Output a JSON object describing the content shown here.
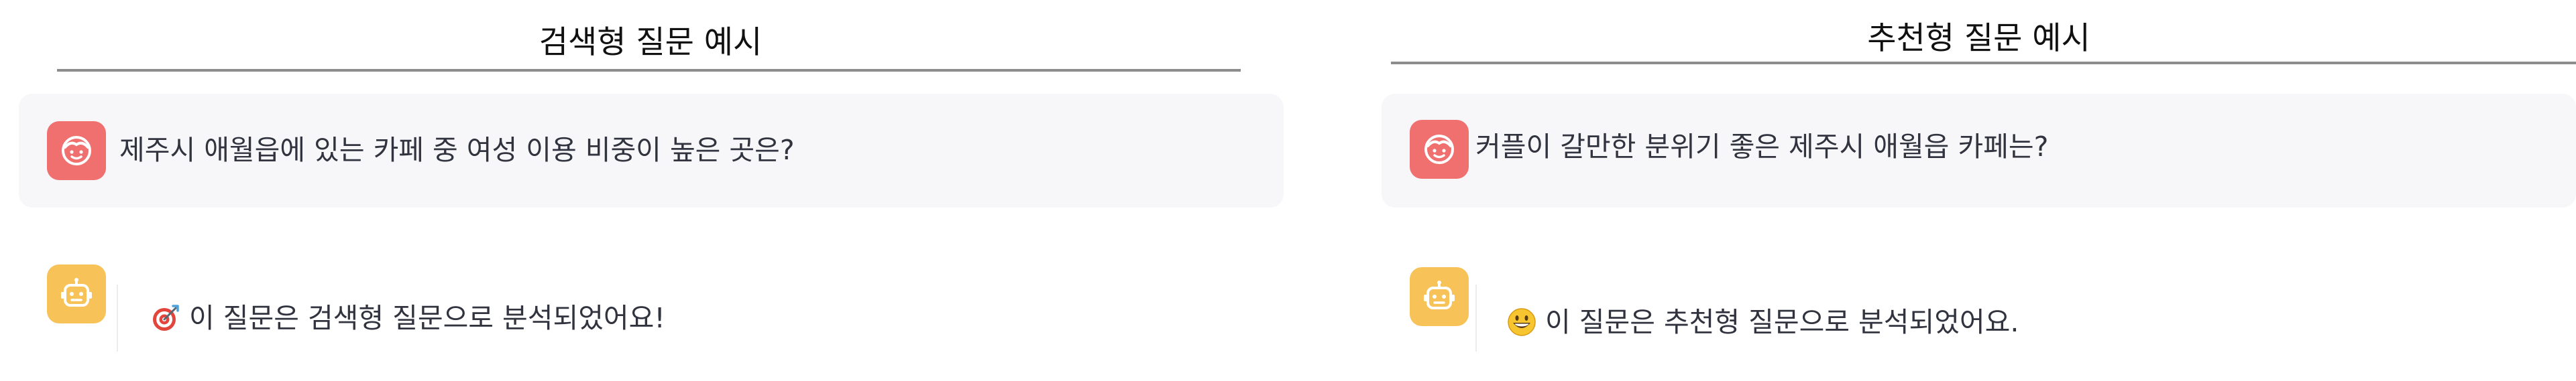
{
  "search_example": {
    "title": "검색형 질문 예시",
    "user_message": "제주시 애월읍에 있는 카페 중 여성 이용 비중이 높은 곳은?",
    "user_avatar_icon": "user-face-icon",
    "bot_avatar_icon": "robot-face-icon",
    "bot_emoji_icon": "target-dart-icon",
    "bot_message": "이 질문은 검색형 질문으로 분석되었어요!"
  },
  "recommend_example": {
    "title": "추천형 질문 예시",
    "user_message": "커플이 갈만한 분위기 좋은 제주시 애월읍 카페는?",
    "user_avatar_icon": "user-face-icon",
    "bot_avatar_icon": "robot-face-icon",
    "bot_emoji_icon": "grinning-face-icon",
    "bot_message": "이 질문은 추천형 질문으로 분석되었어요."
  },
  "colors": {
    "user_avatar": "#f06f6f",
    "bot_avatar": "#f7c258",
    "message_background": "#f7f7f9",
    "divider": "#8c8c8c"
  }
}
